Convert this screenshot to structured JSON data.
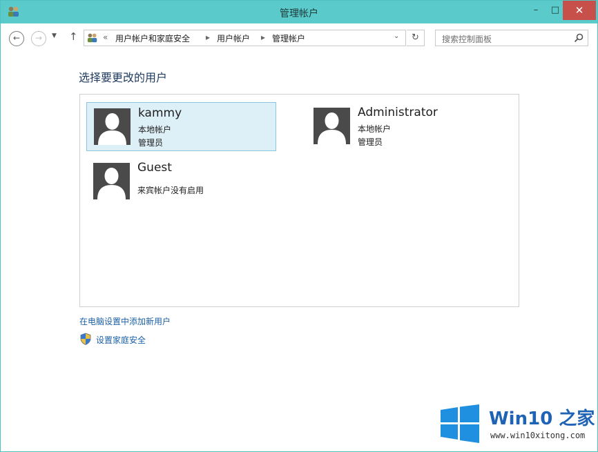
{
  "window": {
    "title": "管理帐户",
    "minimize_glyph": "–",
    "maximize_glyph": "□",
    "close_glyph": "✕"
  },
  "nav": {
    "back_glyph": "←",
    "forward_glyph": "→",
    "recent_glyph": "▼",
    "up_glyph": "↑",
    "breadcrumb_overflow": "«",
    "breadcrumbs": [
      "用户帐户和家庭安全",
      "用户帐户",
      "管理帐户"
    ],
    "crumb_separator": "▸",
    "dropdown_glyph": "⌄",
    "refresh_glyph": "↻"
  },
  "search": {
    "placeholder": "搜索控制面板"
  },
  "main": {
    "heading": "选择要更改的用户",
    "users": [
      {
        "name": "kammy",
        "type": "本地帐户",
        "role": "管理员",
        "selected": true
      },
      {
        "name": "Administrator",
        "type": "本地帐户",
        "role": "管理员",
        "selected": false
      },
      {
        "name": "Guest",
        "status": "来宾帐户没有启用",
        "selected": false
      }
    ],
    "links": {
      "add_user": "在电脑设置中添加新用户",
      "family_safety": "设置家庭安全"
    }
  },
  "watermark": {
    "brand": "Win10 之家",
    "url": "www.win10xitong.com"
  },
  "colors": {
    "titlebar": "#5bcaca",
    "close_button": "#c7504a",
    "selection_bg": "#ddeff7",
    "selection_border": "#8ec5de",
    "link": "#1b60a5",
    "heading": "#1e3a5f",
    "brand": "#1f63b5"
  },
  "icons": {
    "app": "users-control-panel-icon",
    "avatar": "user-silhouette-icon",
    "search": "magnifier-icon",
    "shield": "uac-shield-icon",
    "logo": "windows-logo-icon"
  }
}
